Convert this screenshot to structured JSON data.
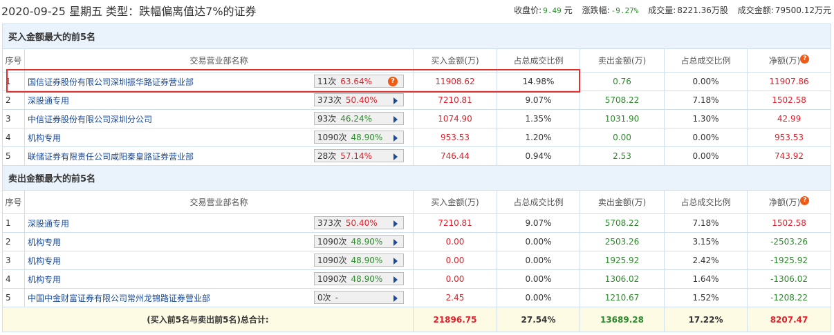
{
  "header": {
    "title": "2020-09-25 星期五  类型：跌幅偏离值达7%的证券",
    "close_label": "收盘价:",
    "close_value": "9.49",
    "close_unit": "元",
    "change_label": "涨跌幅:",
    "change_value": "-9.27%",
    "volume_label": "成交量:",
    "volume_value": "8221.36万股",
    "amount_label": "成交金额:",
    "amount_value": "79500.12万元"
  },
  "columns": [
    "序号",
    "交易营业部名称",
    "买入金额(万)",
    "占总成交比例",
    "卖出金额(万)",
    "占总成交比例",
    "净额(万)"
  ],
  "buy_section": {
    "title": "买入金额最大的前5名",
    "rows": [
      {
        "seq": "1",
        "name": "国信证券股份有限公司深圳振华路证券营业部",
        "count": "11次",
        "pct": "63.64%",
        "pct_color": "red",
        "icon": "question",
        "buy": "11908.62",
        "buy_ratio": "14.98%",
        "sell": "0.76",
        "sell_ratio": "0.00%",
        "net": "11907.86"
      },
      {
        "seq": "2",
        "name": "深股通专用",
        "count": "373次",
        "pct": "50.40%",
        "pct_color": "red",
        "icon": "arrow",
        "buy": "7210.81",
        "buy_ratio": "9.07%",
        "sell": "5708.22",
        "sell_ratio": "7.18%",
        "net": "1502.58"
      },
      {
        "seq": "3",
        "name": "中信证券股份有限公司深圳分公司",
        "count": "93次",
        "pct": "46.24%",
        "pct_color": "green",
        "icon": "arrow",
        "buy": "1074.90",
        "buy_ratio": "1.35%",
        "sell": "1031.90",
        "sell_ratio": "1.30%",
        "net": "42.99"
      },
      {
        "seq": "4",
        "name": "机构专用",
        "count": "1090次",
        "pct": "48.90%",
        "pct_color": "green",
        "icon": "arrow",
        "buy": "953.53",
        "buy_ratio": "1.20%",
        "sell": "0.00",
        "sell_ratio": "0.00%",
        "net": "953.53"
      },
      {
        "seq": "5",
        "name": "联储证券有限责任公司咸阳秦皇路证券营业部",
        "count": "28次",
        "pct": "57.14%",
        "pct_color": "red",
        "icon": "arrow",
        "buy": "746.44",
        "buy_ratio": "0.94%",
        "sell": "2.53",
        "sell_ratio": "0.00%",
        "net": "743.92"
      }
    ]
  },
  "sell_section": {
    "title": "卖出金额最大的前5名",
    "rows": [
      {
        "seq": "1",
        "name": "深股通专用",
        "count": "373次",
        "pct": "50.40%",
        "pct_color": "red",
        "icon": "arrow",
        "buy": "7210.81",
        "buy_ratio": "9.07%",
        "sell": "5708.22",
        "sell_ratio": "7.18%",
        "net": "1502.58"
      },
      {
        "seq": "2",
        "name": "机构专用",
        "count": "1090次",
        "pct": "48.90%",
        "pct_color": "green",
        "icon": "arrow",
        "buy": "0.00",
        "buy_ratio": "0.00%",
        "sell": "2503.26",
        "sell_ratio": "3.15%",
        "net": "-2503.26"
      },
      {
        "seq": "3",
        "name": "机构专用",
        "count": "1090次",
        "pct": "48.90%",
        "pct_color": "green",
        "icon": "arrow",
        "buy": "0.00",
        "buy_ratio": "0.00%",
        "sell": "1925.92",
        "sell_ratio": "2.42%",
        "net": "-1925.92"
      },
      {
        "seq": "4",
        "name": "机构专用",
        "count": "1090次",
        "pct": "48.90%",
        "pct_color": "green",
        "icon": "arrow",
        "buy": "0.00",
        "buy_ratio": "0.00%",
        "sell": "1306.02",
        "sell_ratio": "1.64%",
        "net": "-1306.02"
      },
      {
        "seq": "5",
        "name": "中国中金财富证券有限公司常州龙锦路证券营业部",
        "count": "0次",
        "pct": "-",
        "pct_color": "none",
        "icon": "arrow",
        "buy": "2.45",
        "buy_ratio": "0.00%",
        "sell": "1210.67",
        "sell_ratio": "1.52%",
        "net": "-1208.22"
      }
    ]
  },
  "total": {
    "label": "(买入前5名与卖出前5名)总合计:",
    "buy": "21896.75",
    "buy_ratio": "27.54%",
    "sell": "13689.28",
    "sell_ratio": "17.22%",
    "net": "8207.47"
  }
}
